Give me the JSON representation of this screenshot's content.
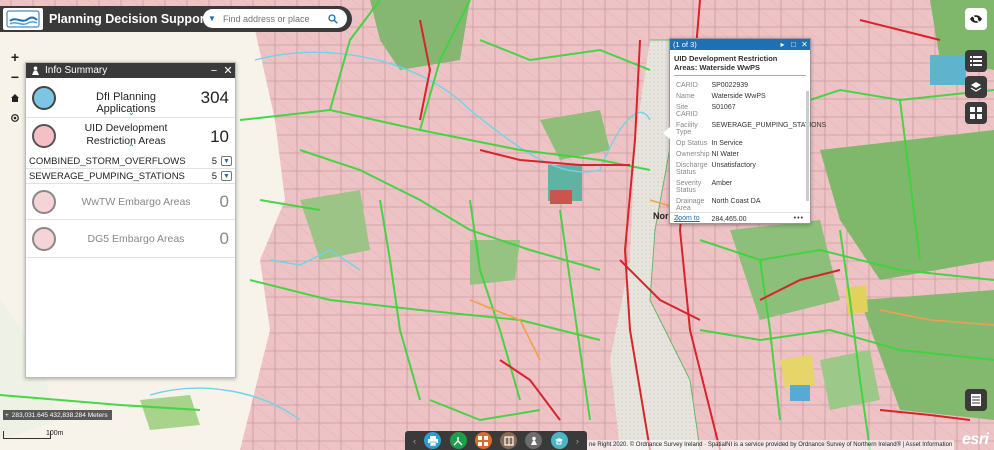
{
  "header": {
    "app_title": "Planning Decision Support Tool",
    "logo_icon": "northern-ireland-logo",
    "search_placeholder": "Find address or place",
    "search_icon": "search-icon",
    "dropdown_icon": "chevron-down-icon"
  },
  "map_controls": {
    "zoom_in": "+",
    "zoom_out": "−",
    "home_icon": "home-icon",
    "locate_icon": "locate-icon"
  },
  "info_summary": {
    "title": "Info Summary",
    "minimize": "−",
    "close": "✕",
    "items": [
      {
        "label": "DfI Planning Applications",
        "count": "304",
        "icon": "planning-application-icon"
      },
      {
        "label": "UID Development Restriction Areas",
        "count": "10",
        "icon": "restriction-area-icon"
      }
    ],
    "sub_items": [
      {
        "label": "COMBINED_STORM_OVERFLOWS",
        "count": "5"
      },
      {
        "label": "SEWERAGE_PUMPING_STATIONS",
        "count": "5"
      }
    ],
    "grey_items": [
      {
        "label": "WwTW Embargo Areas",
        "count": "0"
      },
      {
        "label": "DG5 Embargo Areas",
        "count": "0"
      }
    ]
  },
  "popup": {
    "pager": "(1 of 3)",
    "title": "UID Development Restriction Areas: Waterside WwPS",
    "fields": [
      {
        "k": "CARID",
        "v": "SP0022939"
      },
      {
        "k": "Name",
        "v": "Waterside WwPS"
      },
      {
        "k": "Site CARID",
        "v": "S01067"
      },
      {
        "k": "Facility Type",
        "v": "SEWERAGE_PUMPING_STATIONS"
      },
      {
        "k": "Op Status",
        "v": "In Service"
      },
      {
        "k": "Ownership",
        "v": "NI Water"
      },
      {
        "k": "Discharge Status",
        "v": "Unsatisfactory"
      },
      {
        "k": "Severity Status",
        "v": "Amber"
      },
      {
        "k": "Drainage Area",
        "v": "North Coast DA"
      },
      {
        "k": "X",
        "v": "284,465.00"
      }
    ],
    "zoom_to": "Zoom to",
    "more": "•••"
  },
  "map": {
    "place_label": "Nor",
    "coordinates": "283,031.645 432,838.284 Meters",
    "scale_label": "100m",
    "attribution": "ne Right 2020. © Ordnance Survey Ireland · SpatialNI is a service provided by Ordnance Survey of Northern Ireland® | Asset Information",
    "esri": "esri"
  },
  "right_toolbar": [
    "visibility-off-icon",
    "legend-list-icon",
    "layers-icon",
    "basemap-gallery-icon",
    "attribute-table-icon"
  ],
  "dock": [
    "print-icon",
    "analysis-icon",
    "grid-tool-icon",
    "measure-icon",
    "directions-icon",
    "draw-icon"
  ],
  "colors": {
    "header": "#3a3a3a",
    "accent": "#1f6fb5",
    "pink_area": "#f0c8c8",
    "green_area": "#7fb86a",
    "road_red": "#d8232a",
    "road_green": "#4cc84c",
    "river": "#e8e4dc"
  }
}
